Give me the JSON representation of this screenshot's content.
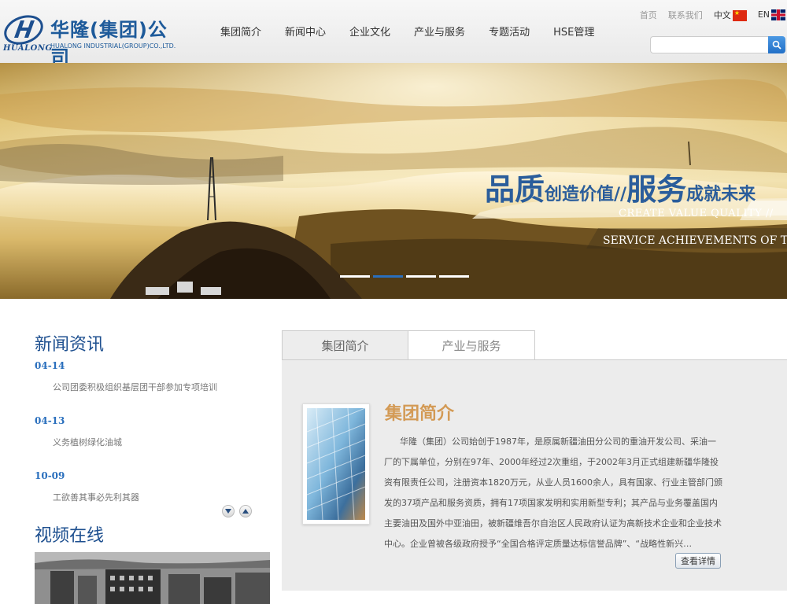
{
  "logo": {
    "name_cn": "华隆(集团)公司",
    "name_en": "HUALONG INDUSTRIAL(GROUP)CO.,LTD.",
    "mark_text": "HUALONG"
  },
  "nav": {
    "items": [
      "集团简介",
      "新闻中心",
      "企业文化",
      "产业与服务",
      "专题活动",
      "HSE管理"
    ]
  },
  "toplinks": {
    "home": "首页",
    "contact": "联系我们",
    "lang_cn": "中文",
    "lang_en": "EN"
  },
  "search": {
    "placeholder": ""
  },
  "banner": {
    "slogan_cn_big1": "品质",
    "slogan_cn_small1": "创造价值//",
    "slogan_cn_big2": "服务",
    "slogan_cn_small2": "成就未来",
    "slogan_en1": "CREATE VALUE QUALITY //",
    "slogan_en2": "SERVICE ACHIEVEMENTS OF THE FUTU",
    "slide_count": 4,
    "active_slide": 2
  },
  "news": {
    "title": "新闻资讯",
    "items": [
      {
        "date": "04-14",
        "text": "公司团委积极组织基层团干部参加专项培训"
      },
      {
        "date": "04-13",
        "text": "义务植树绿化油城"
      },
      {
        "date": "10-09",
        "text": "工欲善其事必先利其器"
      }
    ]
  },
  "video": {
    "title": "视频在线"
  },
  "tabs": {
    "items": [
      "集团简介",
      "产业与服务"
    ],
    "active": 0
  },
  "panel": {
    "heading": "集团简介",
    "text": "华隆（集团）公司始创于1987年，是原属新疆油田分公司的重油开发公司、采油一厂的下属单位，分别在97年、2000年经过2次重组，于2002年3月正式组建新疆华隆投资有限责任公司，注册资本1820万元，从业人员1600余人，具有国家、行业主管部门颁发的37项产品和服务资质，拥有17项国家发明和实用新型专利；其产品与业务覆盖国内主要油田及国外中亚油田，被新疆维吾尔自治区人民政府认证为高新技术企业和企业技术中心。企业曾被各级政府授予“全国合格评定质量达标信誉品牌”、“战略性新兴…",
    "more_label": "查看详情"
  },
  "colors": {
    "brand_blue": "#1d4f8f",
    "accent_orange": "#d39a55",
    "link_blue": "#2a6fbd"
  }
}
